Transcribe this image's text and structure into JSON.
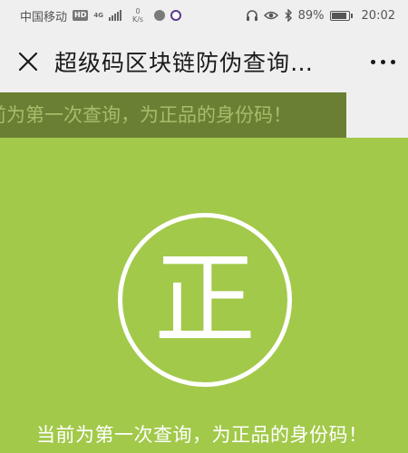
{
  "status_bar": {
    "carrier": "中国移动",
    "hd_badge": "HD",
    "network_type": "4G",
    "speed_value": "0",
    "speed_unit": "K/s",
    "battery_percent": "89%",
    "battery_level": 0.89,
    "time": "20:02",
    "icons": [
      "hd-icon",
      "signal-icon",
      "chat-app-icon",
      "purple-app-icon",
      "headset-icon",
      "eye-icon",
      "bluetooth-icon",
      "battery-icon"
    ]
  },
  "nav": {
    "title": "超级码区块链防伪查询…",
    "close_icon": "close-icon",
    "more_icon": "more-icon"
  },
  "marquee": {
    "text": "前为第一次查询，为正品的身份码！"
  },
  "seal": {
    "character": "正"
  },
  "message": {
    "text": "当前为第一次查询，为正品的身份码！"
  },
  "colors": {
    "background_green": "#a2c94a",
    "marquee_band": "#6a7f33",
    "marquee_text": "#a7bd6b",
    "bar_gray": "#efefef",
    "white": "#ffffff"
  }
}
